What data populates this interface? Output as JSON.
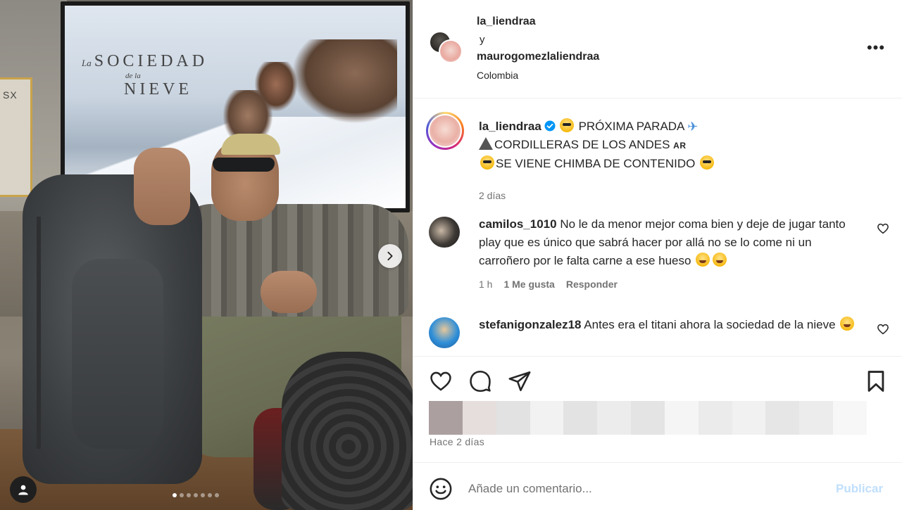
{
  "media": {
    "shelf_label": "SX",
    "poster_title_la": "La",
    "poster_title_sociedad": "SOCIEDAD",
    "poster_title_dela": "de la",
    "poster_title_nieve": "NIEVE",
    "carousel_total": 7,
    "carousel_active": 1
  },
  "header": {
    "user1": "la_liendraa",
    "and": "y",
    "user2": "maurogomezlaliendraa",
    "location": "Colombia",
    "more": "•••"
  },
  "caption": {
    "username": "la_liendraa",
    "line1": "PRÓXIMA PARADA",
    "line2": "CORDILLERAS DE LOS ANDES",
    "line2_flag": "AR",
    "line3": "SE VIENE CHIMBA DE CONTENIDO",
    "time": "2 días"
  },
  "comments": [
    {
      "username": "camilos_1010",
      "text": "No le da menor mejor coma bien y deje de jugar tanto play que es único que sabrá hacer por allá no se lo come ni un carroñero por le falta carne a ese hueso",
      "time": "1 h",
      "likes": "1 Me gusta",
      "reply": "Responder"
    },
    {
      "username": "stefanigonzalez18",
      "text": "Antes era el titani ahora la sociedad de la nieve"
    }
  ],
  "footer": {
    "posted_ago": "Hace 2 días",
    "comment_placeholder": "Añade un comentario...",
    "post_label": "Publicar"
  },
  "colors": {
    "verified": "#0095f6",
    "post_disabled": "#c0dffd",
    "muted_text": "#737373"
  }
}
